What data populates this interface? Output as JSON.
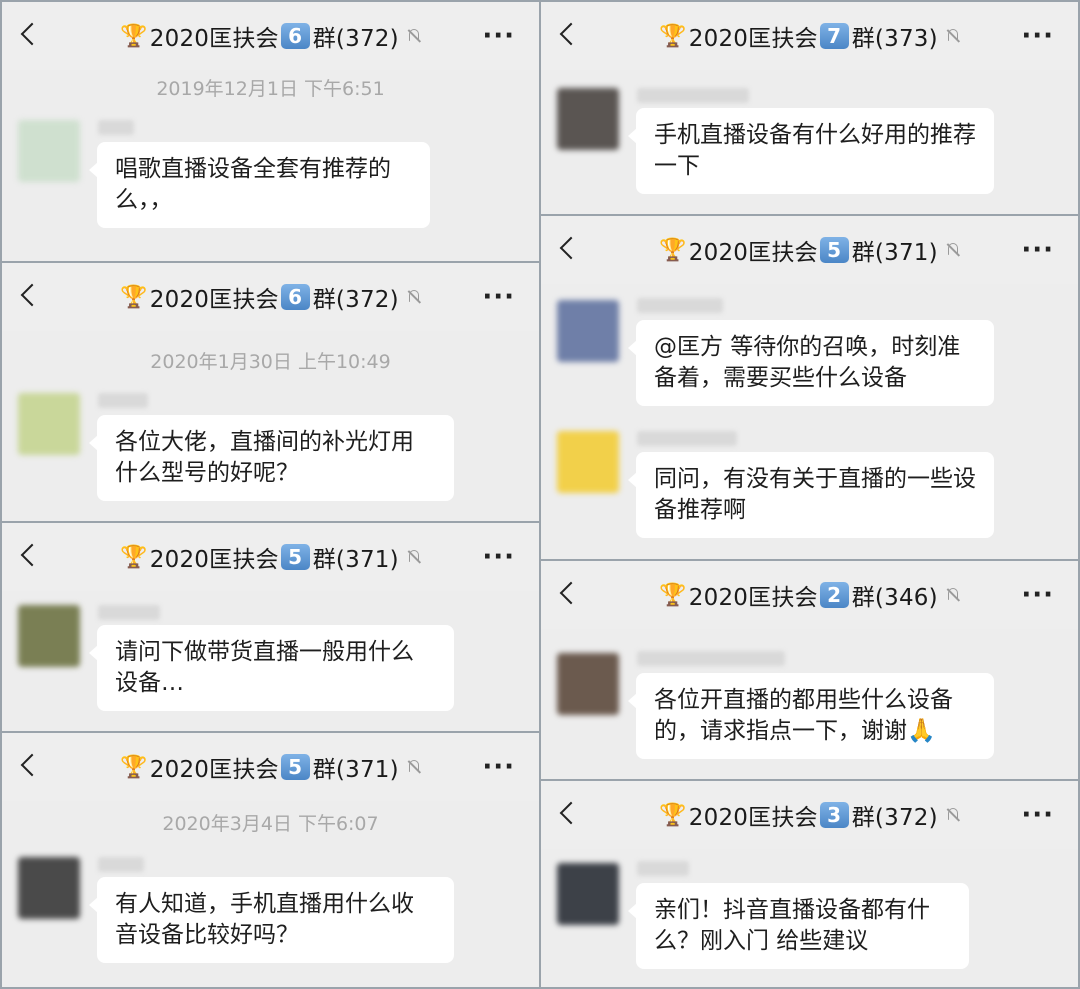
{
  "panels": [
    {
      "title": {
        "prefix": "2020匡扶会",
        "number": "6",
        "suffix": "群(372)"
      },
      "timestamp": "2019年12月1日 下午6:51",
      "messages": [
        {
          "text": "唱歌直播设备全套有推荐的么，，",
          "avatar_color": "#cfe0cf"
        }
      ]
    },
    {
      "title": {
        "prefix": "2020匡扶会",
        "number": "6",
        "suffix": "群(372)"
      },
      "timestamp": "2020年1月30日 上午10:49",
      "messages": [
        {
          "text": "各位大佬，直播间的补光灯用什么型号的好呢？",
          "avatar_color": "#c9d79a"
        }
      ]
    },
    {
      "title": {
        "prefix": "2020匡扶会",
        "number": "5",
        "suffix": "群(371)"
      },
      "messages": [
        {
          "text": "请问下做带货直播一般用什么设备…",
          "avatar_color": "#7a7f54"
        }
      ]
    },
    {
      "title": {
        "prefix": "2020匡扶会",
        "number": "5",
        "suffix": "群(371)"
      },
      "timestamp": "2020年3月4日 下午6:07",
      "messages": [
        {
          "text": "有人知道，手机直播用什么收音设备比较好吗？",
          "avatar_color": "#4a4a4a"
        }
      ]
    },
    {
      "title": {
        "prefix": "2020匡扶会",
        "number": "7",
        "suffix": "群(373)"
      },
      "messages": [
        {
          "text": "手机直播设备有什么好用的推荐一下",
          "avatar_color": "#5a5552"
        }
      ]
    },
    {
      "title": {
        "prefix": "2020匡扶会",
        "number": "5",
        "suffix": "群(371)"
      },
      "messages": [
        {
          "text": "@匡方 等待你的召唤，时刻准备着，需要买些什么设备",
          "avatar_color": "#6f7fa8"
        },
        {
          "text": "同问，有没有关于直播的一些设备推荐啊",
          "avatar_color": "#f2d04a"
        }
      ]
    },
    {
      "title": {
        "prefix": "2020匡扶会",
        "number": "2",
        "suffix": "群(346)"
      },
      "messages": [
        {
          "text": "各位开直播的都用些什么设备的，请求指点一下，谢谢🙏",
          "avatar_color": "#6b5a4e"
        }
      ]
    },
    {
      "title": {
        "prefix": "2020匡扶会",
        "number": "3",
        "suffix": "群(372)"
      },
      "messages": [
        {
          "text": "亲们！抖音直播设备都有什么？刚入门 给些建议",
          "avatar_color": "#3d4148"
        }
      ]
    }
  ]
}
